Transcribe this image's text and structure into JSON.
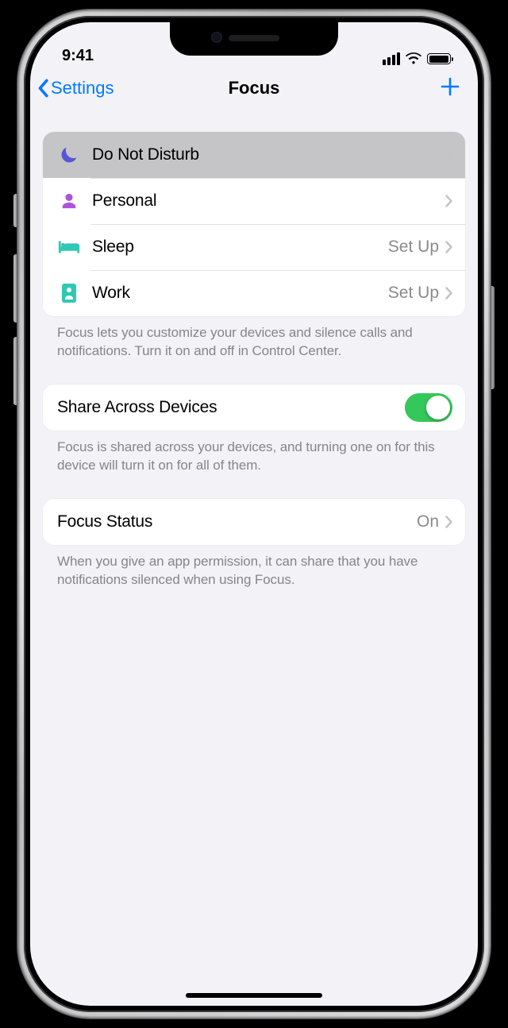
{
  "status": {
    "time": "9:41"
  },
  "nav": {
    "back_label": "Settings",
    "title": "Focus"
  },
  "focus_modes": [
    {
      "icon": "moon",
      "color": "#5856D6",
      "label": "Do Not Disturb",
      "detail": "",
      "highlighted": true
    },
    {
      "icon": "person",
      "color": "#AF52DE",
      "label": "Personal",
      "detail": "",
      "highlighted": false
    },
    {
      "icon": "bed",
      "color": "#30C7B5",
      "label": "Sleep",
      "detail": "Set Up",
      "highlighted": false
    },
    {
      "icon": "badge",
      "color": "#30C7B5",
      "label": "Work",
      "detail": "Set Up",
      "highlighted": false
    }
  ],
  "footer1": "Focus lets you customize your devices and silence calls and notifications. Turn it on and off in Control Center.",
  "share": {
    "label": "Share Across Devices",
    "on": true
  },
  "footer2": "Focus is shared across your devices, and turning one on for this device will turn it on for all of them.",
  "status_row": {
    "label": "Focus Status",
    "value": "On"
  },
  "footer3": "When you give an app permission, it can share that you have notifications silenced when using Focus."
}
